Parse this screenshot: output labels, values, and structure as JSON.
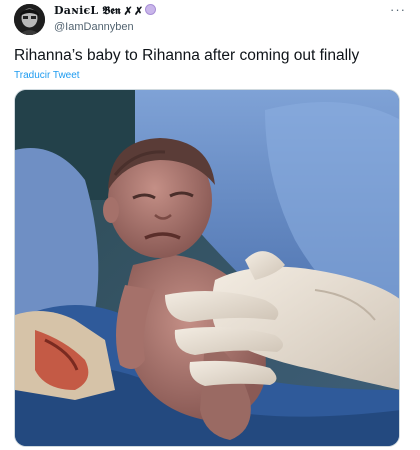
{
  "tweet": {
    "author": {
      "display_name": "DaɴiєL 𝕭𝖊𝖓 ✗ ✗",
      "handle": "@IamDannyben"
    },
    "text": "Rihanna’s baby to Rihanna after coming out finally",
    "translate_label": "Traducir Tweet",
    "more_icon": "···",
    "media_alt": "newborn baby held by gloved hands with a frowning expression"
  },
  "colors": {
    "link": "#1d9bf0",
    "secondary_text": "#536471",
    "scrub_blue": "#5f86c0"
  }
}
